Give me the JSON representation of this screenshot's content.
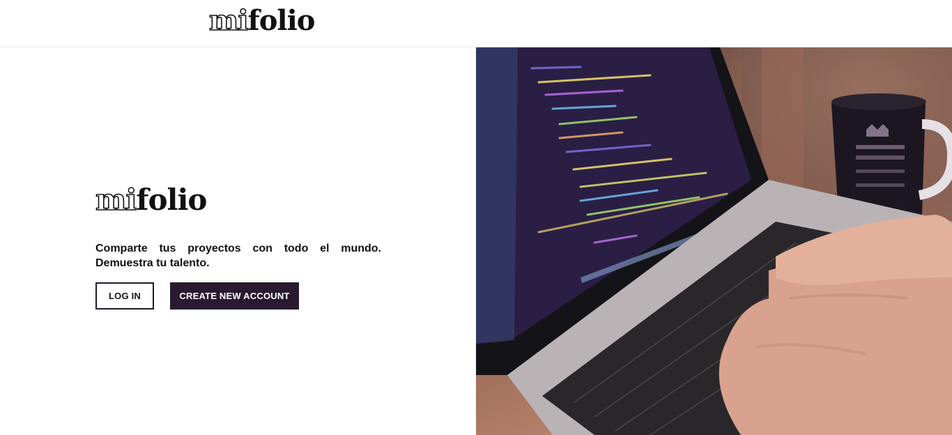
{
  "header": {
    "logo_mi": "mi",
    "logo_folio": "folio"
  },
  "hero_left": {
    "logo_mi": "mi",
    "logo_folio": "folio",
    "tagline": "Comparte tus proyectos con todo el mundo. Demuestra tu talento.",
    "login_label": "LOG IN",
    "create_label": "CREATE NEW ACCOUNT"
  },
  "hero_image": {
    "description_icon": "laptop-coding-photo",
    "mug_text": "KEEP CALM"
  },
  "colors": {
    "primary": "#2a1a2f",
    "border": "#1b1b2a",
    "background": "#ffffff"
  }
}
